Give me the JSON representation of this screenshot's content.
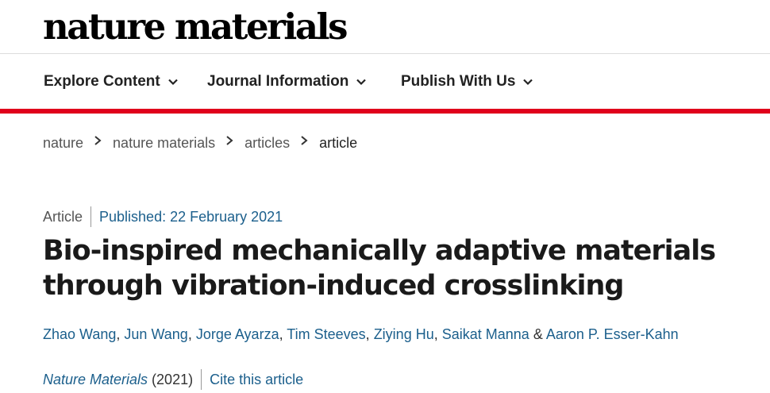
{
  "site": {
    "logo": "nature materials"
  },
  "nav": {
    "items": [
      {
        "label": "Explore Content"
      },
      {
        "label": "Journal Information"
      },
      {
        "label": "Publish With Us"
      }
    ]
  },
  "breadcrumb": {
    "items": [
      "nature",
      "nature materials",
      "articles"
    ],
    "current": "article"
  },
  "article": {
    "type": "Article",
    "published": "Published: 22 February 2021",
    "title": "Bio-inspired mechanically adaptive materials through vibration-induced crosslinking",
    "authors": [
      "Zhao Wang",
      "Jun Wang",
      "Jorge Ayarza",
      "Tim Steeves",
      "Ziying Hu",
      "Saikat Manna",
      "Aaron P. Esser-Kahn"
    ],
    "author_sep": ",",
    "author_last_sep": "&",
    "journal": "Nature Materials",
    "year": "(2021)",
    "cite_label": "Cite this article"
  },
  "colors": {
    "accent_red": "#e0001b",
    "link_blue": "#1b5f8c"
  },
  "icons": {
    "nav_dropdown": "chevron-down-icon",
    "breadcrumb_separator": "chevron-right-icon"
  }
}
